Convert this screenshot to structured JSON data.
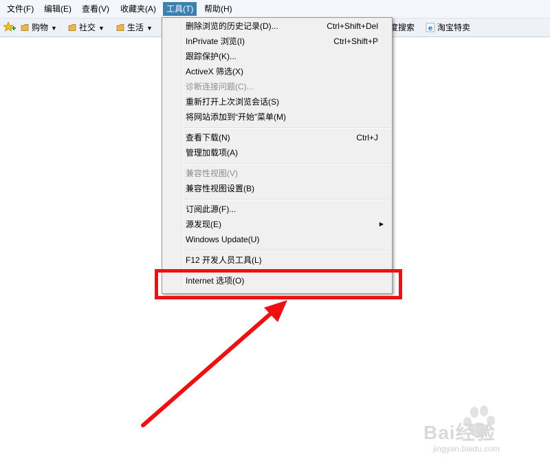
{
  "menubar": {
    "items": [
      {
        "label": "文件(F)"
      },
      {
        "label": "编辑(E)"
      },
      {
        "label": "查看(V)"
      },
      {
        "label": "收藏夹(A)"
      },
      {
        "label": "工具(T)"
      },
      {
        "label": "帮助(H)"
      }
    ]
  },
  "favorites": {
    "folders": [
      {
        "label": "购物"
      },
      {
        "label": "社交"
      },
      {
        "label": "生活"
      }
    ],
    "partial_label": "度搜索",
    "taobao_label": "淘宝特卖"
  },
  "tools_menu": {
    "items": [
      {
        "label": "删除浏览的历史记录(D)...",
        "shortcut": "Ctrl+Shift+Del"
      },
      {
        "label": "InPrivate 浏览(I)",
        "shortcut": "Ctrl+Shift+P"
      },
      {
        "label": "跟踪保护(K)..."
      },
      {
        "label": "ActiveX 筛选(X)"
      },
      {
        "label": "诊断连接问题(C)...",
        "disabled": true
      },
      {
        "label": "重新打开上次浏览会话(S)"
      },
      {
        "label": "将网站添加到“开始”菜单(M)"
      },
      {
        "label": "查看下载(N)",
        "shortcut": "Ctrl+J"
      },
      {
        "label": "管理加载项(A)"
      },
      {
        "label": "兼容性视图(V)",
        "disabled": true
      },
      {
        "label": "兼容性视图设置(B)"
      },
      {
        "label": "订阅此源(F)..."
      },
      {
        "label": "源发现(E)",
        "submenu": true
      },
      {
        "label": "Windows Update(U)"
      },
      {
        "label": "F12 开发人员工具(L)"
      },
      {
        "label": "Internet 选项(O)"
      }
    ]
  },
  "watermark": {
    "brand": "Bai经验",
    "url": "jingyan.baidu.com"
  },
  "colors": {
    "annotation_red": "#ee1111",
    "menu_active": "#3c7fb1"
  }
}
